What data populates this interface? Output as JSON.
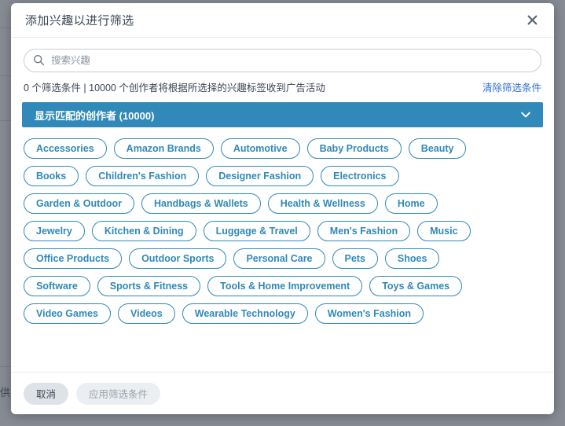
{
  "dialog": {
    "title": "添加兴趣以进行筛选",
    "close_icon": "close-icon"
  },
  "search": {
    "placeholder": "搜索兴趣",
    "value": "",
    "icon": "search-icon"
  },
  "status": {
    "text": "0 个筛选条件 | 10000 个创作者将根据所选择的兴趣标签收到广告活动",
    "clear_label": "清除筛选条件"
  },
  "match_banner": {
    "label": "显示匹配的创作者 (10000)",
    "icon": "chevron-down-icon",
    "color": "#3089b8"
  },
  "tag_rows": [
    [
      "Accessories",
      "Amazon Brands",
      "Automotive",
      "Baby Products",
      "Beauty"
    ],
    [
      "Books",
      "Children's Fashion",
      "Designer Fashion",
      "Electronics"
    ],
    [
      "Garden & Outdoor",
      "Handbags & Wallets",
      "Health & Wellness",
      "Home"
    ],
    [
      "Jewelry",
      "Kitchen & Dining",
      "Luggage & Travel",
      "Men's Fashion",
      "Music"
    ],
    [
      "Office Products",
      "Outdoor Sports",
      "Personal Care",
      "Pets",
      "Shoes"
    ],
    [
      "Software",
      "Sports & Fitness",
      "Tools & Home Improvement",
      "Toys & Games"
    ],
    [
      "Video Games",
      "Videos",
      "Wearable Technology",
      "Women's Fashion"
    ]
  ],
  "footer": {
    "cancel_label": "取消",
    "apply_label": "应用筛选条件"
  },
  "background": {
    "partial_text": "供"
  },
  "colors": {
    "accent": "#3089b8",
    "link": "#2f6fd0",
    "text": "#3c4655"
  }
}
